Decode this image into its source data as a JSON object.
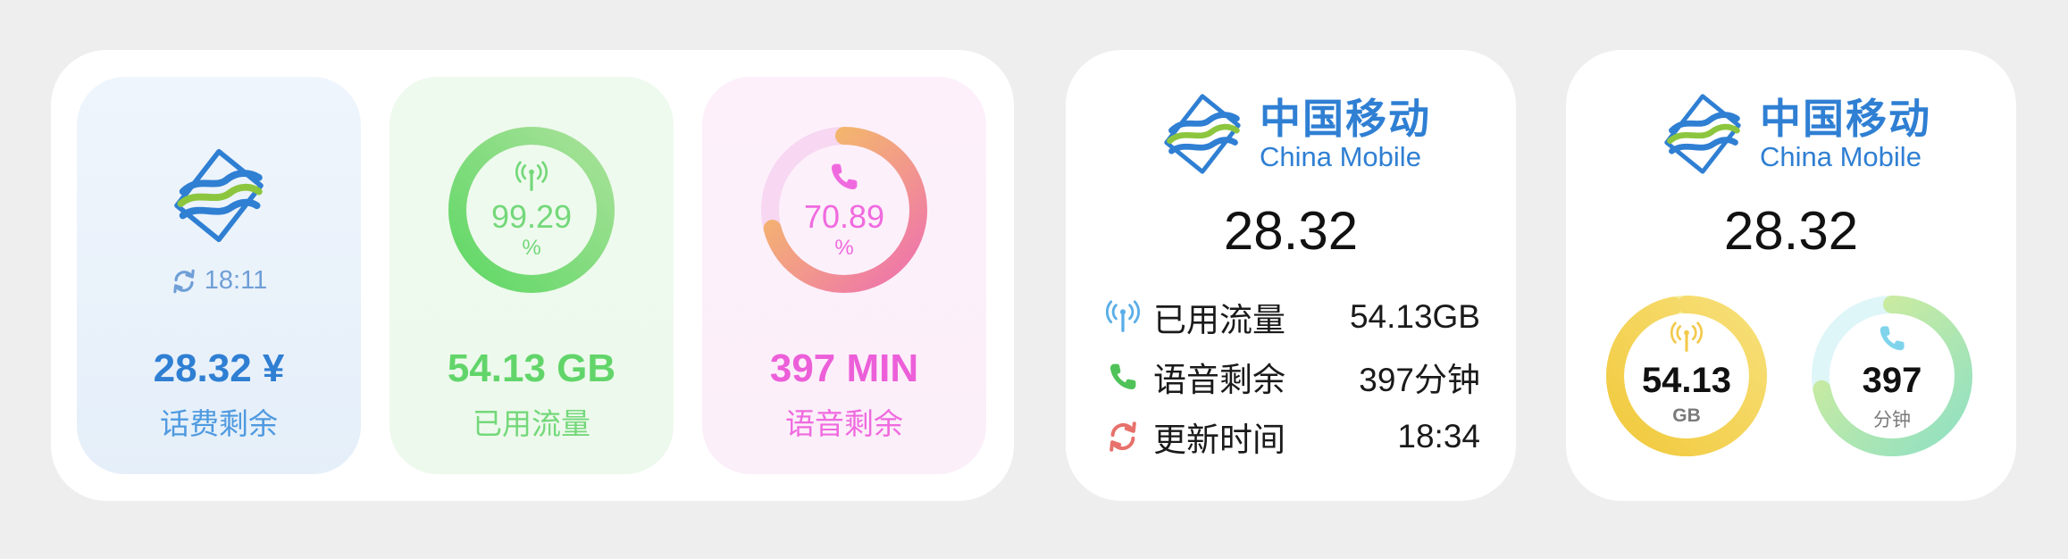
{
  "colors": {
    "fee": "#2f7fd3",
    "data": "#6fd872",
    "voice": "#f06adf",
    "brand": "#2f7fd3"
  },
  "large_widget": {
    "fee": {
      "time": "18:11",
      "value": "28.32 ¥",
      "label": "话费剩余",
      "icon": "china-mobile-logo"
    },
    "data": {
      "percent": "99.29",
      "percent_unit": "%",
      "percent_fraction": 0.9929,
      "value": "54.13 GB",
      "label": "已用流量",
      "icon": "signal-tower-icon"
    },
    "voice": {
      "percent": "70.89",
      "percent_unit": "%",
      "percent_fraction": 0.7089,
      "value": "397 MIN",
      "label": "语音剩余",
      "icon": "phone-icon"
    }
  },
  "mid_widget": {
    "brand_cn": "中国移动",
    "brand_en": "China Mobile",
    "amount": "28.32",
    "rows": [
      {
        "label": "已用流量",
        "value": "54.13GB",
        "icon": "signal-tower-icon"
      },
      {
        "label": "语音剩余",
        "value": "397分钟",
        "icon": "phone-icon"
      },
      {
        "label": "更新时间",
        "value": "18:34",
        "icon": "refresh-icon"
      }
    ]
  },
  "small_widget": {
    "brand_cn": "中国移动",
    "brand_en": "China Mobile",
    "amount": "28.32",
    "data_ring": {
      "value": "54.13",
      "unit": "GB",
      "fraction": 0.97,
      "icon": "signal-tower-icon"
    },
    "voice_ring": {
      "value": "397",
      "unit": "分钟",
      "fraction": 0.72,
      "icon": "phone-icon"
    }
  }
}
